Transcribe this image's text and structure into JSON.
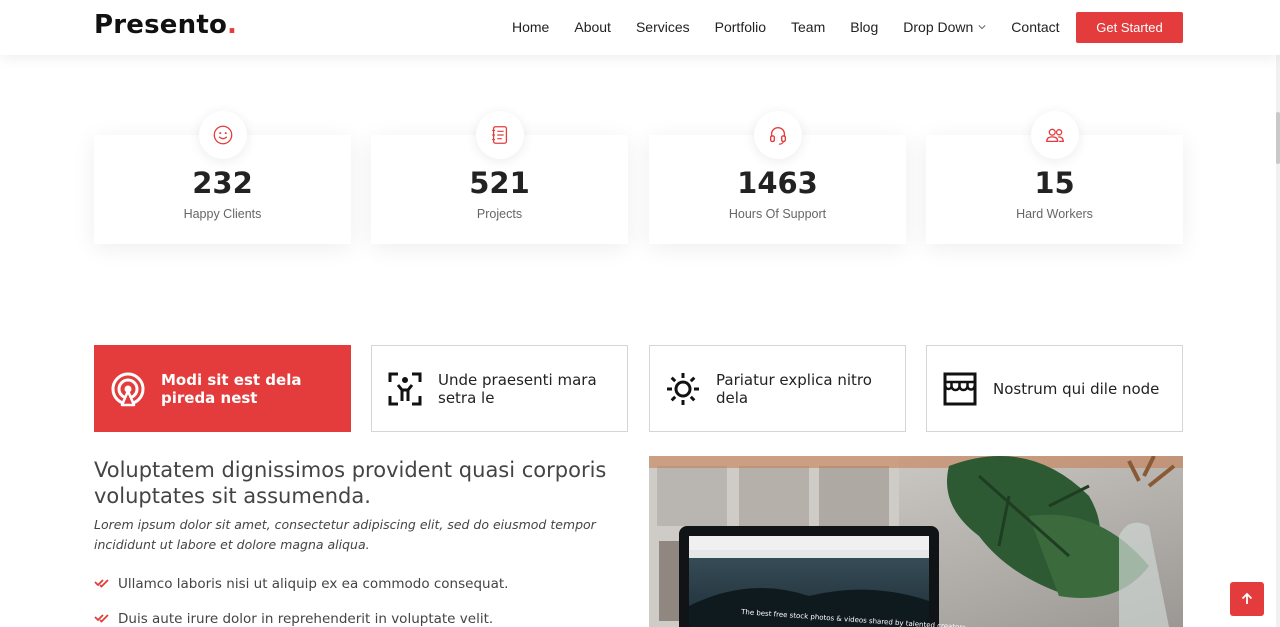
{
  "brand": {
    "name": "Presento",
    "dot": ".",
    "accent": "#e43c3c"
  },
  "nav": {
    "items": [
      "Home",
      "About",
      "Services",
      "Portfolio",
      "Team",
      "Blog",
      "Drop Down",
      "Contact"
    ],
    "cta": "Get Started"
  },
  "counters": [
    {
      "icon": "smile-icon",
      "value": "232",
      "label": "Happy Clients"
    },
    {
      "icon": "journal-icon",
      "value": "521",
      "label": "Projects"
    },
    {
      "icon": "headset-icon",
      "value": "1463",
      "label": "Hours Of Support"
    },
    {
      "icon": "people-icon",
      "value": "15",
      "label": "Hard Workers"
    }
  ],
  "tabs": [
    {
      "icon": "broadcast-icon",
      "label": "Modi sit est dela pireda nest",
      "active": true
    },
    {
      "icon": "body-scan-icon",
      "label": "Unde praesenti mara setra le",
      "active": false
    },
    {
      "icon": "sun-icon",
      "label": "Pariatur explica nitro dela",
      "active": false
    },
    {
      "icon": "store-icon",
      "label": "Nostrum qui dile node",
      "active": false
    }
  ],
  "content": {
    "title": "Voluptatem dignissimos provident quasi corporis voluptates sit assumenda.",
    "lead": "Lorem ipsum dolor sit amet, consectetur adipiscing elit, sed do eiusmod tempor incididunt ut labore et dolore magna aliqua.",
    "checks": [
      "Ullamco laboris nisi ut aliquip ex ea commodo consequat.",
      "Duis aute irure dolor in reprehenderit in voluptate velit."
    ]
  },
  "photo": {
    "screen_headline": "The best free stock photos & videos shared by talented creators."
  }
}
